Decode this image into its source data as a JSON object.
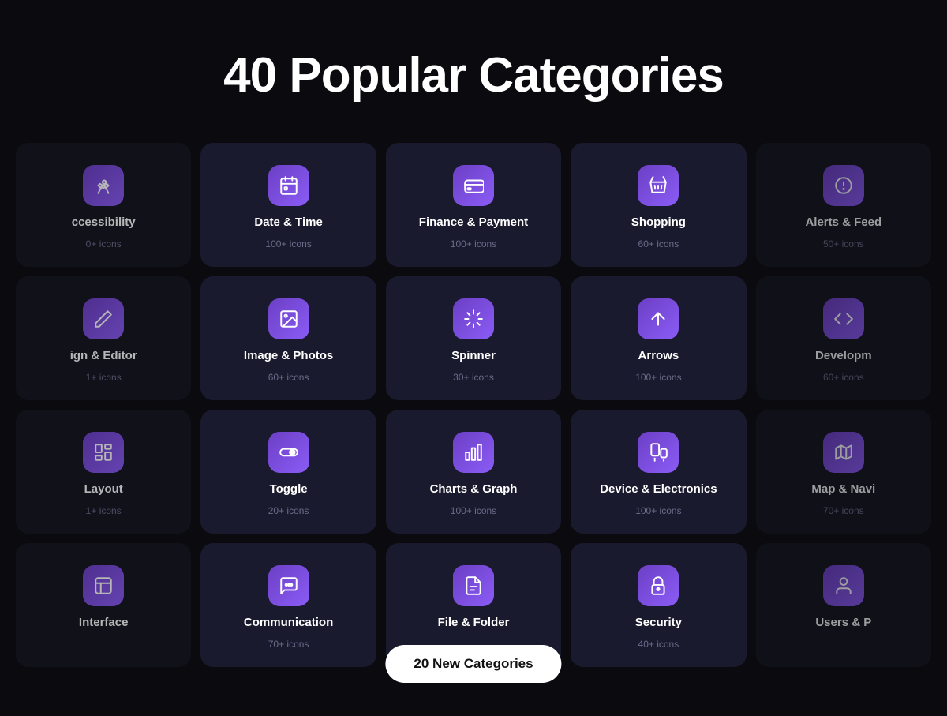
{
  "page": {
    "title": "40 Popular Categories"
  },
  "badge": {
    "label": "20 New Categories"
  },
  "rows": [
    [
      {
        "id": "accessibility",
        "name": "ccessibility",
        "count": "0+ icons",
        "icon": "accessibility",
        "partial": "left"
      },
      {
        "id": "date-time",
        "name": "Date & Time",
        "count": "100+ icons",
        "icon": "calendar"
      },
      {
        "id": "finance-payment",
        "name": "Finance & Payment",
        "count": "100+ icons",
        "icon": "card"
      },
      {
        "id": "shopping",
        "name": "Shopping",
        "count": "60+ icons",
        "icon": "basket"
      },
      {
        "id": "alerts-feed",
        "name": "Alerts & Feed",
        "count": "50+ icons",
        "icon": "alert",
        "partial": "right"
      }
    ],
    [
      {
        "id": "design-editor",
        "name": "ign & Editor",
        "count": "1+ icons",
        "icon": "pen",
        "partial": "left"
      },
      {
        "id": "image-photos",
        "name": "Image & Photos",
        "count": "60+ icons",
        "icon": "image"
      },
      {
        "id": "spinner",
        "name": "Spinner",
        "count": "30+ icons",
        "icon": "spinner"
      },
      {
        "id": "arrows",
        "name": "Arrows",
        "count": "100+ icons",
        "icon": "arrow-up"
      },
      {
        "id": "development",
        "name": "Developm",
        "count": "60+ icons",
        "icon": "code",
        "partial": "right"
      }
    ],
    [
      {
        "id": "layout",
        "name": "Layout",
        "count": "1+ icons",
        "icon": "layout",
        "partial": "left"
      },
      {
        "id": "toggle",
        "name": "Toggle",
        "count": "20+ icons",
        "icon": "toggle"
      },
      {
        "id": "charts-graph",
        "name": "Charts & Graph",
        "count": "100+ icons",
        "icon": "chart"
      },
      {
        "id": "device-electronics",
        "name": "Device & Electronics",
        "count": "100+ icons",
        "icon": "device"
      },
      {
        "id": "map-navi",
        "name": "Map & Navi",
        "count": "70+ icons",
        "icon": "map",
        "partial": "right"
      }
    ],
    [
      {
        "id": "interface",
        "name": "Interface",
        "count": "",
        "icon": "interface",
        "partial": "left"
      },
      {
        "id": "communication",
        "name": "Communication",
        "count": "70+ icons",
        "icon": "chat"
      },
      {
        "id": "file-folder",
        "name": "File & Folder",
        "count": "",
        "icon": "file"
      },
      {
        "id": "security",
        "name": "Security",
        "count": "40+ icons",
        "icon": "lock"
      },
      {
        "id": "users",
        "name": "Users & P",
        "count": "",
        "icon": "user",
        "partial": "right"
      }
    ]
  ]
}
